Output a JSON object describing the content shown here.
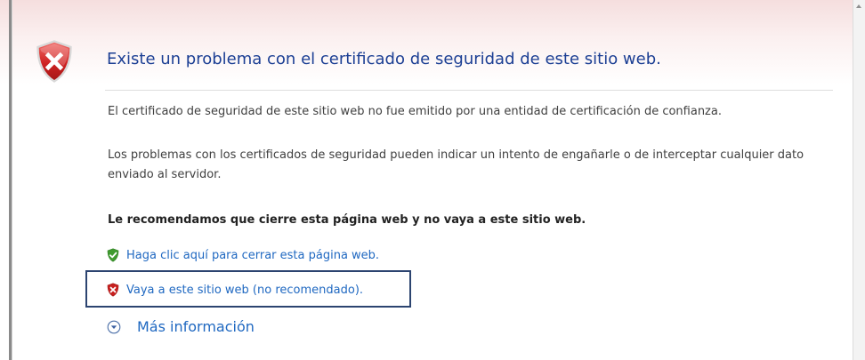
{
  "page": {
    "title": "Existe un problema con el certificado de seguridad de este sitio web.",
    "paragraph1": "El certificado de seguridad de este sitio web no fue emitido por una entidad de certificación de confianza.",
    "paragraph2": "Los problemas con los certificados de seguridad pueden indicar un intento de engañarle o de interceptar cualquier dato enviado al servidor.",
    "recommendation": "Le recomendamos que cierre esta página web y no vaya a este sitio web."
  },
  "links": {
    "close_page": "Haga clic aquí para cerrar esta página web.",
    "continue_site": "Vaya a este sitio web (no recomendado).",
    "more_info": "Más información"
  },
  "icons": {
    "main": "security-error-shield-icon",
    "close_link": "green-check-shield-icon",
    "continue_link": "red-x-shield-icon",
    "more_info": "chevron-down-circle-icon"
  },
  "colors": {
    "title": "#1c3f94",
    "link": "#1f68c1",
    "highlight_border": "#2c4470",
    "error_red": "#c8201f",
    "success_green": "#3f9b2f"
  }
}
